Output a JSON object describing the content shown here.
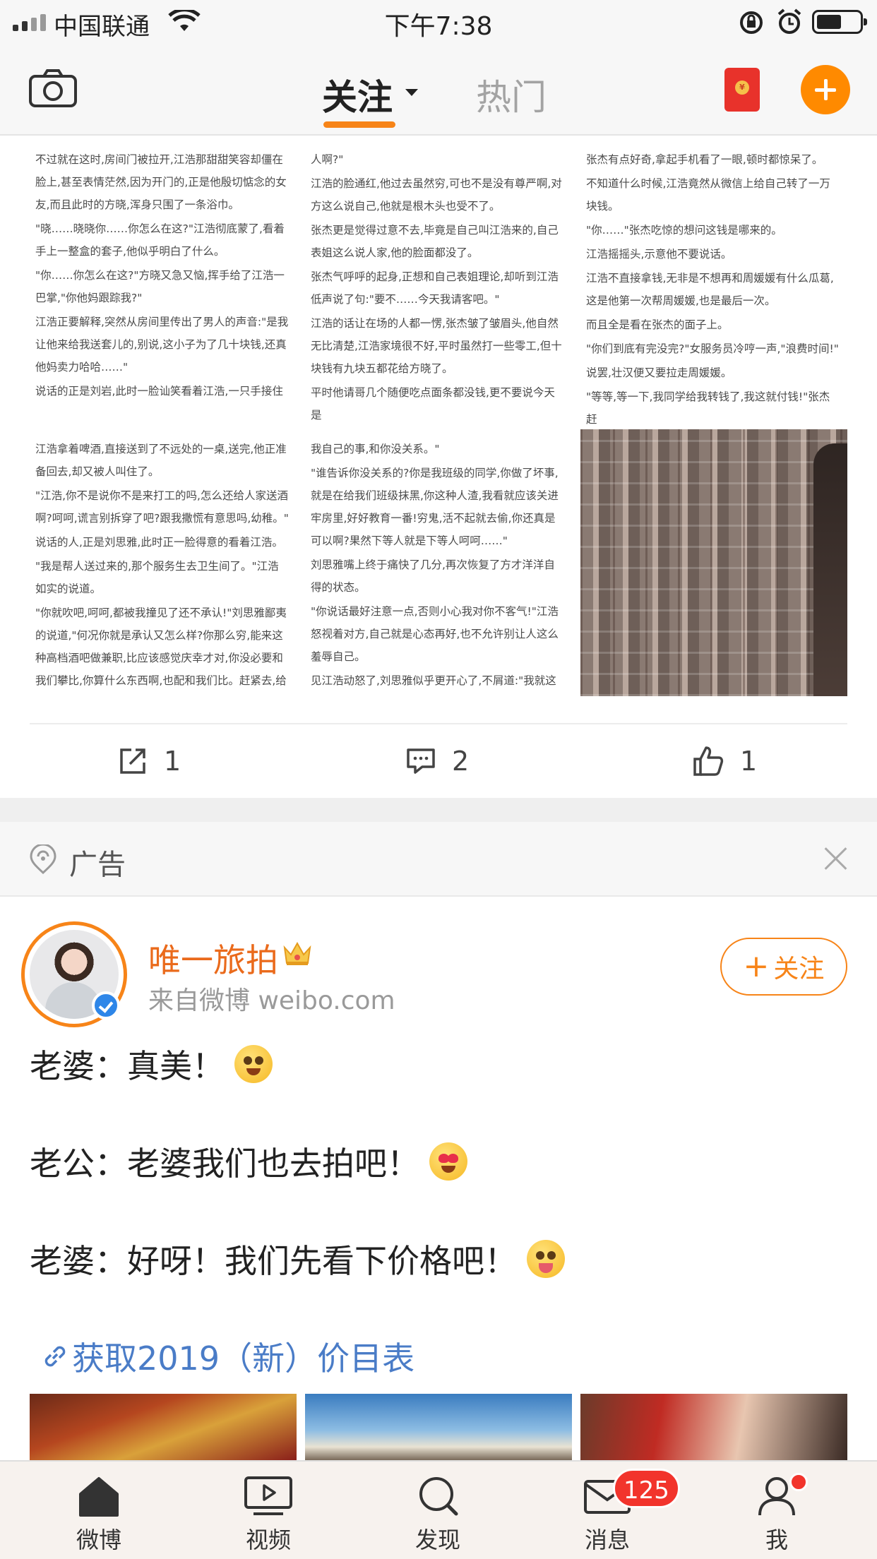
{
  "status_bar": {
    "carrier": "中国联通",
    "time": "下午7:38"
  },
  "top_nav": {
    "tab_follow": "关注",
    "tab_hot": "热门",
    "red_packet_glyph": "¥"
  },
  "article": {
    "col1_top": [
      "不过就在这时,房间门被拉开,江浩那甜甜笑容却僵在脸上,甚至表情茫然,因为开门的,正是他殷切惦念的女友,而且此时的方晓,浑身只围了一条浴巾。",
      "\"晓……晓晓你……你怎么在这?\"江浩彻底蒙了,看着手上一整盒的套子,他似乎明白了什么。",
      "\"你……你怎么在这?\"方晓又急又恼,挥手给了江浩一巴掌,\"你他妈跟踪我?\"",
      "江浩正要解释,突然从房间里传出了男人的声音:\"是我让他来给我送套儿的,别说,这小子为了几十块钱,还真他妈卖力哈哈……\"",
      "说话的正是刘岩,此时一脸讪笑看着江浩,一只手接住"
    ],
    "col1_bottom": [
      "江浩拿着啤酒,直接送到了不远处的一桌,送完,他正准备回去,却又被人叫住了。",
      "\"江浩,你不是说你不是来打工的吗,怎么还给人家送酒啊?呵呵,谎言别拆穿了吧?跟我撒慌有意思吗,幼稚。\"",
      "说话的人,正是刘思雅,此时正一脸得意的看着江浩。",
      "\"我是帮人送过来的,那个服务生去卫生间了。\"江浩如实的说道。",
      "\"你就吹吧,呵呵,都被我撞见了还不承认!\"刘思雅鄙夷的说道,\"何况你就是承认又怎么样?你那么穷,能来这种高档酒吧做兼职,比应该感觉庆幸才对,你没必要和我们攀比,你算什么东西啊,也配和我们比。赶紧去,给"
    ],
    "col2_top": [
      "人啊?\"",
      "江浩的脸通红,他过去虽然穷,可也不是没有尊严啊,对方这么说自己,他就是根木头也受不了。",
      "张杰更是觉得过意不去,毕竟是自己叫江浩来的,自己表姐这么说人家,他的脸面都没了。",
      "张杰气呼呼的起身,正想和自己表姐理论,却听到江浩低声说了句:\"要不……今天我请客吧。\"",
      "江浩的话让在场的人都一愣,张杰皱了皱眉头,他自然无比清楚,江浩家境很不好,平时虽然打一些零工,但十块钱有九块五都花给方晓了。",
      "平时他请哥几个随便吃点面条都没钱,更不要说今天是"
    ],
    "col2_bottom": [
      "我自己的事,和你没关系。\"",
      "\"谁告诉你没关系的?你是我班级的同学,你做了坏事,就是在给我们班级抹黑,你这种人渣,我看就应该关进牢房里,好好教育一番!穷鬼,活不起就去偷,你还真是可以啊?果然下等人就是下等人呵呵……\"",
      "刘思雅嘴上终于痛快了几分,再次恢复了方才洋洋自得的状态。",
      "\"你说话最好注意一点,否则小心我对你不客气!\"江浩怒视着对方,自己就是心态再好,也不允许别让人这么羞辱自己。",
      "见江浩动怒了,刘思雅似乎更开心了,不屑道:\"我就这么"
    ],
    "col3_top": [
      "张杰有点好奇,拿起手机看了一眼,顿时都惊呆了。",
      "不知道什么时候,江浩竟然从微信上给自己转了一万块钱。",
      "\"你……\"张杰吃惊的想问这钱是哪来的。",
      "江浩摇摇头,示意他不要说话。",
      "江浩不直接拿钱,无非是不想再和周媛媛有什么瓜葛,这是他第一次帮周媛媛,也是最后一次。",
      "而且全是看在张杰的面子上。",
      "\"你们到底有完没完?\"女服务员冷哼一声,\"浪费时间!\"",
      "说罢,壮汉便又要拉走周媛媛。",
      "\"等等,等一下,我同学给我转钱了,我这就付钱!\"张杰赶"
    ]
  },
  "actions": {
    "repost_count": "1",
    "comment_count": "2",
    "like_count": "1"
  },
  "ad": {
    "label": "广告"
  },
  "post": {
    "author": "唯一旅拍",
    "source": "来自微博 weibo.com",
    "follow_label": "关注",
    "lines": [
      "老婆：真美！",
      "老公：老婆我们也去拍吧！",
      "老婆：好呀！我们先看下价格吧！"
    ],
    "link_text": "获取2019（新）价目表"
  },
  "tab_bar": {
    "items": [
      {
        "label": "微博"
      },
      {
        "label": "视频"
      },
      {
        "label": "发现"
      },
      {
        "label": "消息"
      },
      {
        "label": "我"
      }
    ],
    "message_badge": "125"
  },
  "colors": {
    "accent": "#f78418",
    "link": "#4a7cc7",
    "badge": "#f2342c"
  }
}
